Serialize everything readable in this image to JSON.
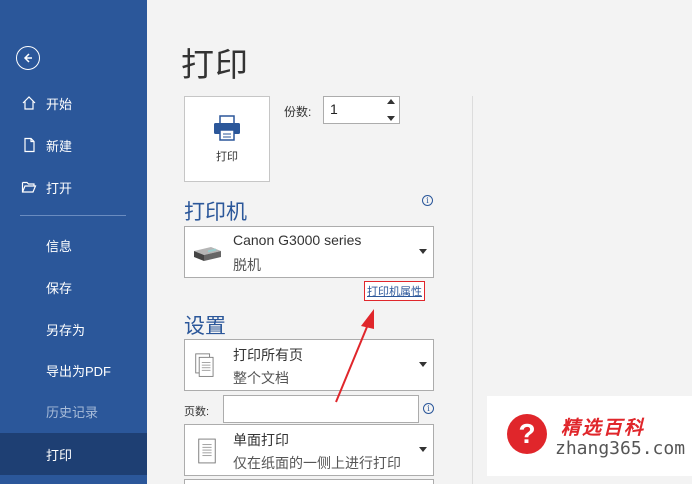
{
  "sidebar": {
    "items": [
      {
        "label": "开始",
        "icon": "home-icon"
      },
      {
        "label": "新建",
        "icon": "new-doc-icon"
      },
      {
        "label": "打开",
        "icon": "open-folder-icon"
      },
      {
        "label": "信息"
      },
      {
        "label": "保存"
      },
      {
        "label": "另存为"
      },
      {
        "label": "导出为PDF"
      },
      {
        "label": "历史记录"
      },
      {
        "label": "打印",
        "active": true
      }
    ]
  },
  "main": {
    "title": "打印",
    "print_button_label": "打印",
    "copies_label": "份数:",
    "copies_value": "1",
    "printer_section_title": "打印机",
    "printer": {
      "name": "Canon G3000 series",
      "status": "脱机"
    },
    "printer_properties_link": "打印机属性",
    "settings_section_title": "设置",
    "print_range": {
      "line1": "打印所有页",
      "line2": "整个文档"
    },
    "pages_label": "页数:",
    "pages_value": "",
    "sides": {
      "line1": "单面打印",
      "line2": "仅在纸面的一侧上进行打印"
    }
  },
  "watermark": {
    "title": "精选百科",
    "site": "zhang365.com",
    "badge": "?"
  },
  "colors": {
    "sidebar": "#2b579a",
    "sidebar_active": "#1e3f73",
    "accent": "#2b579a",
    "highlight": "#e0262b"
  }
}
